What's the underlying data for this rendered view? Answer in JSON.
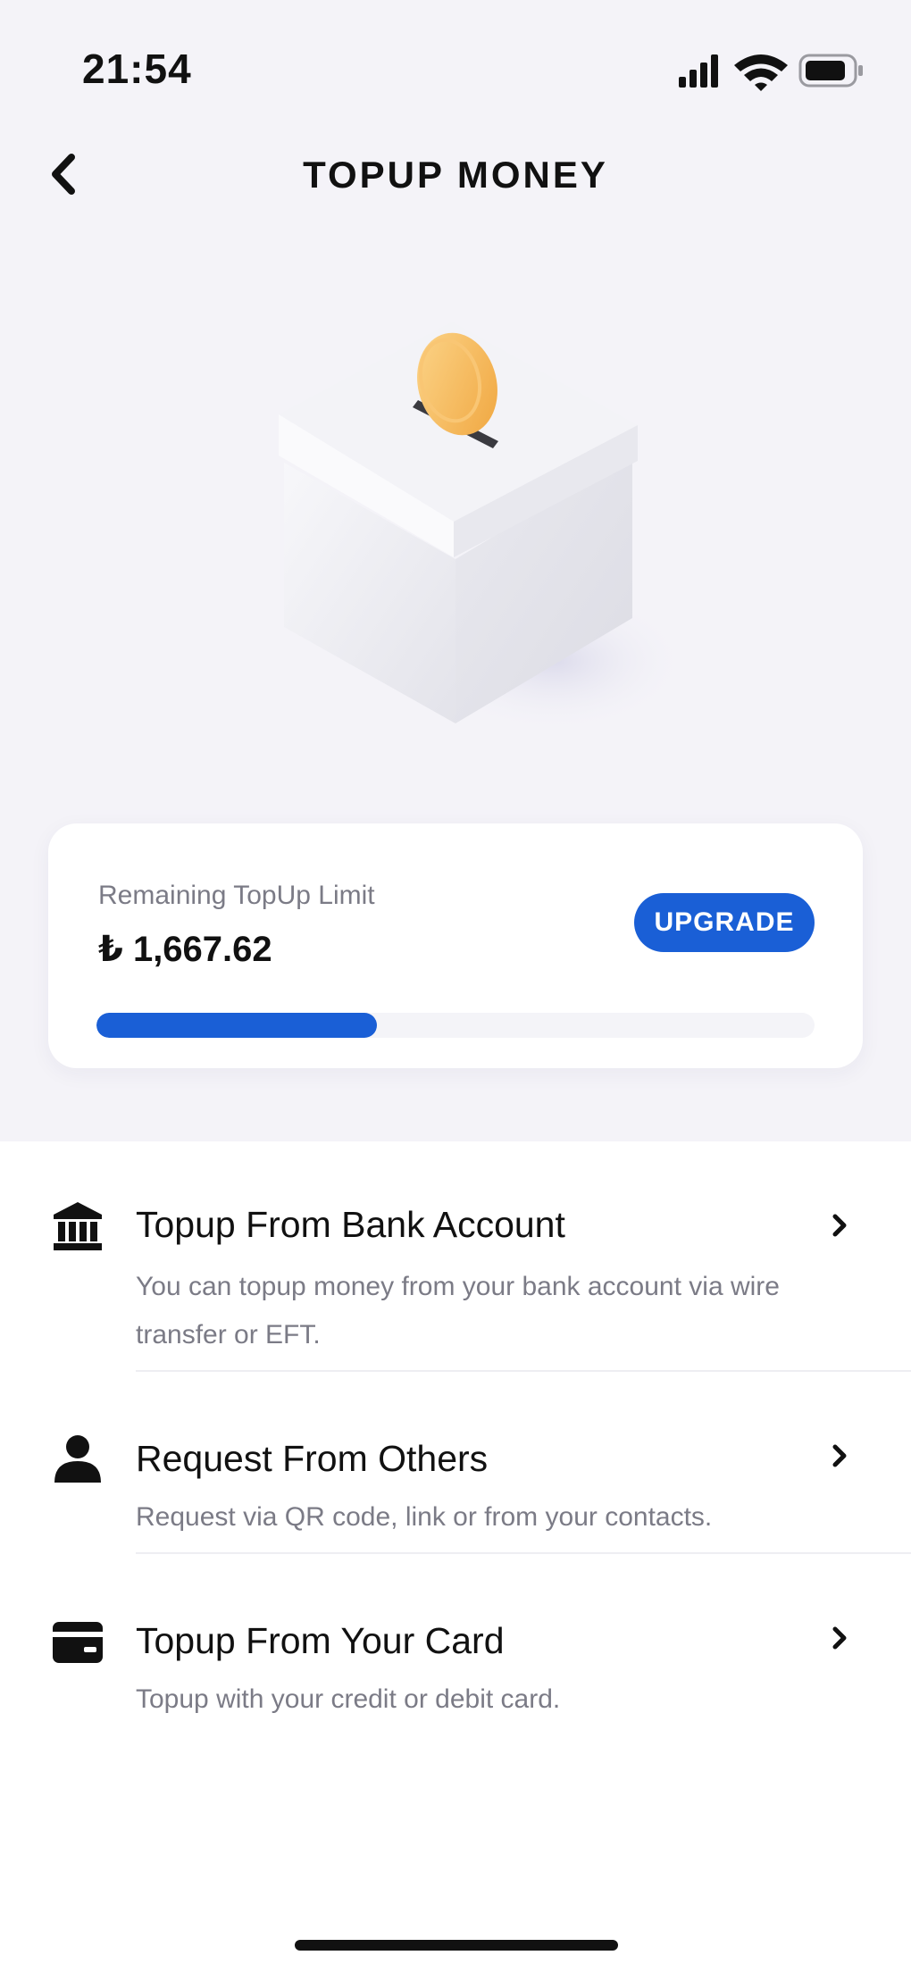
{
  "status_bar": {
    "time": "21:54",
    "icons": [
      "cellular-signal-icon",
      "wifi-icon",
      "battery-icon"
    ]
  },
  "header": {
    "back_icon": "chevron-left-icon",
    "title": "TOPUP MONEY"
  },
  "illustration": {
    "icon": "coin-box-icon",
    "coin_color": "#f7b54e"
  },
  "limit_card": {
    "label": "Remaining TopUp Limit",
    "amount": "₺ 1,667.62",
    "upgrade_label": "UPGRADE",
    "progress_fraction": 0.39,
    "accent_color": "#1a5fd6"
  },
  "options": [
    {
      "icon": "bank-icon",
      "title": "Topup From Bank Account",
      "description": "You can topup money from your bank account via wire transfer or EFT."
    },
    {
      "icon": "person-icon",
      "title": "Request From Others",
      "description": "Request via QR code, link or from your contacts."
    },
    {
      "icon": "credit-card-icon",
      "title": "Topup From Your Card",
      "description": "Topup with your credit or debit card."
    }
  ]
}
